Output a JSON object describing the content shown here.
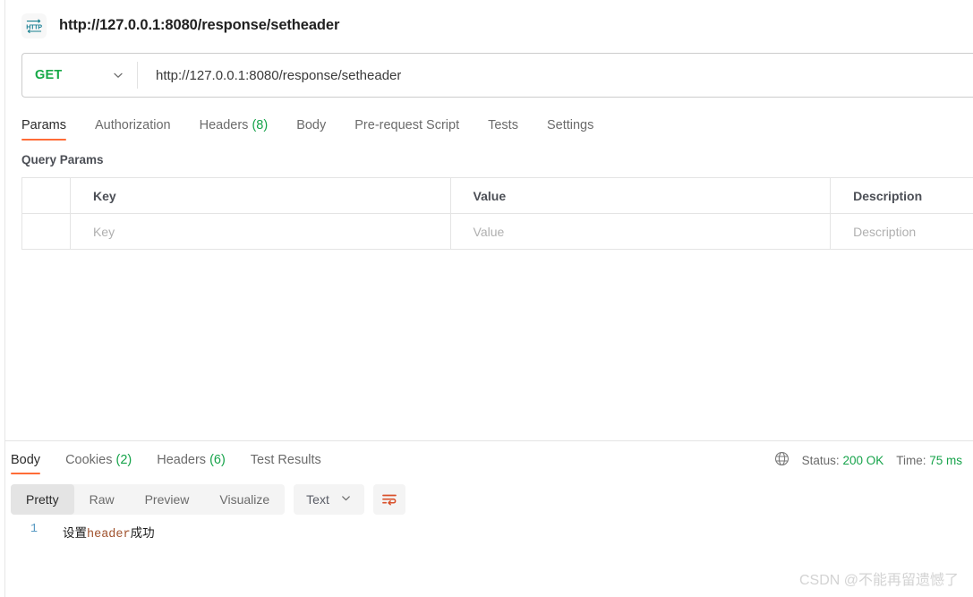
{
  "request": {
    "icon": "http-protocol-icon",
    "title": "http://127.0.0.1:8080/response/setheader",
    "method": "GET",
    "url": "http://127.0.0.1:8080/response/setheader",
    "tabs": [
      {
        "label": "Params",
        "count": null,
        "active": true
      },
      {
        "label": "Authorization",
        "count": null,
        "active": false
      },
      {
        "label": "Headers",
        "count": "(8)",
        "active": false
      },
      {
        "label": "Body",
        "count": null,
        "active": false
      },
      {
        "label": "Pre-request Script",
        "count": null,
        "active": false
      },
      {
        "label": "Tests",
        "count": null,
        "active": false
      },
      {
        "label": "Settings",
        "count": null,
        "active": false
      }
    ],
    "query_params": {
      "section_title": "Query Params",
      "columns": [
        "",
        "Key",
        "Value",
        "Description"
      ],
      "rows": [
        {
          "key": "Key",
          "value": "Value",
          "description": "Description"
        }
      ]
    }
  },
  "response": {
    "tabs": [
      {
        "label": "Body",
        "count": null,
        "active": true
      },
      {
        "label": "Cookies",
        "count": "(2)",
        "active": false
      },
      {
        "label": "Headers",
        "count": "(6)",
        "active": false
      },
      {
        "label": "Test Results",
        "count": null,
        "active": false
      }
    ],
    "meta": {
      "network_icon": "globe-icon",
      "status_label": "Status:",
      "status_value": "200 OK",
      "time_label": "Time:",
      "time_value": "75 ms"
    },
    "view_modes": [
      {
        "label": "Pretty",
        "active": true
      },
      {
        "label": "Raw",
        "active": false
      },
      {
        "label": "Preview",
        "active": false
      },
      {
        "label": "Visualize",
        "active": false
      }
    ],
    "format": "Text",
    "wrap_icon": "word-wrap-icon",
    "body": {
      "line_number": "1",
      "text_prefix": "设置",
      "text_token": "header",
      "text_suffix": "成功"
    }
  },
  "watermark": "CSDN @不能再留遗憾了",
  "colors": {
    "accent": "#ff6c37",
    "success": "#16a34a",
    "method_get": "#17a948",
    "icon_teal": "#177f8f"
  }
}
